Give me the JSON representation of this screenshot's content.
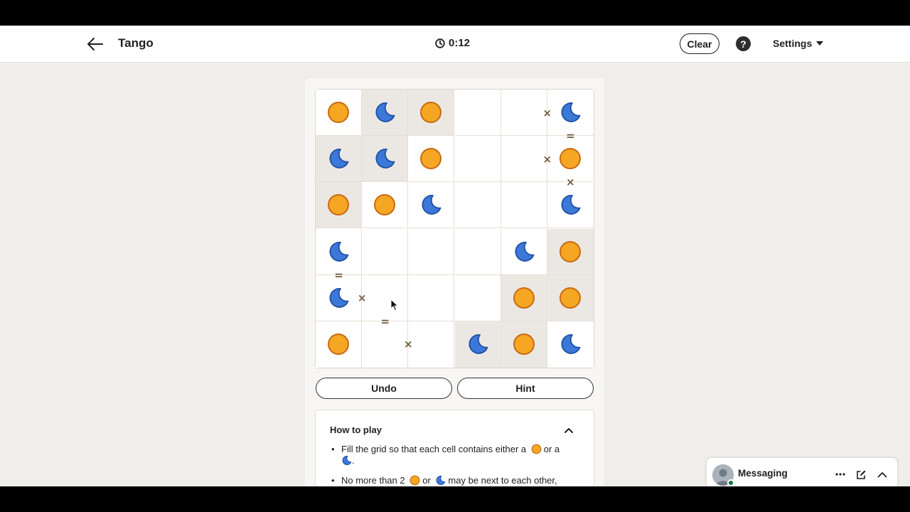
{
  "header": {
    "title": "Tango",
    "timer": "0:12",
    "clear_label": "Clear",
    "help_label": "?",
    "settings_label": "Settings"
  },
  "board": {
    "size": 6,
    "grid": [
      [
        "sun",
        "moon",
        "sun",
        "",
        "",
        "moon"
      ],
      [
        "moon",
        "moon",
        "sun",
        "",
        "",
        "sun"
      ],
      [
        "sun",
        "sun",
        "moon",
        "",
        "",
        "moon"
      ],
      [
        "moon",
        "",
        "",
        "",
        "moon",
        "sun"
      ],
      [
        "moon",
        "",
        "",
        "",
        "sun",
        "sun"
      ],
      [
        "sun",
        "",
        "",
        "moon",
        "sun",
        "moon"
      ]
    ],
    "locked": [
      [
        false,
        true,
        true,
        false,
        false,
        false
      ],
      [
        true,
        true,
        false,
        false,
        false,
        false
      ],
      [
        true,
        false,
        false,
        false,
        false,
        false
      ],
      [
        false,
        false,
        false,
        false,
        false,
        true
      ],
      [
        false,
        false,
        false,
        false,
        true,
        true
      ],
      [
        false,
        false,
        false,
        true,
        true,
        false
      ]
    ],
    "constraints": [
      {
        "a": [
          0,
          4
        ],
        "b": [
          0,
          5
        ],
        "sign": "×"
      },
      {
        "a": [
          0,
          5
        ],
        "b": [
          1,
          5
        ],
        "sign": "="
      },
      {
        "a": [
          1,
          4
        ],
        "b": [
          1,
          5
        ],
        "sign": "×"
      },
      {
        "a": [
          1,
          5
        ],
        "b": [
          2,
          5
        ],
        "sign": "×"
      },
      {
        "a": [
          3,
          0
        ],
        "b": [
          4,
          0
        ],
        "sign": "="
      },
      {
        "a": [
          4,
          0
        ],
        "b": [
          4,
          1
        ],
        "sign": "×"
      },
      {
        "a": [
          4,
          1
        ],
        "b": [
          5,
          1
        ],
        "sign": "="
      },
      {
        "a": [
          5,
          1
        ],
        "b": [
          5,
          2
        ],
        "sign": "×"
      }
    ]
  },
  "actions": {
    "undo_label": "Undo",
    "hint_label": "Hint"
  },
  "how_to_play": {
    "title": "How to play",
    "rule1_a": "Fill the grid so that each cell contains either a",
    "rule1_b": "or a",
    "rule1_c": ".",
    "rule2_a": "No more than 2",
    "rule2_b": "or",
    "rule2_c": "may be next to each other,"
  },
  "messaging": {
    "label": "Messaging"
  },
  "colors": {
    "sun_fill": "#f5a623",
    "sun_stroke": "#c96a12",
    "moon_fill": "#3b78d8",
    "moon_stroke": "#1f4fa3",
    "locked_cell": "#ebe8e4",
    "constraint": "#6f5b40"
  }
}
